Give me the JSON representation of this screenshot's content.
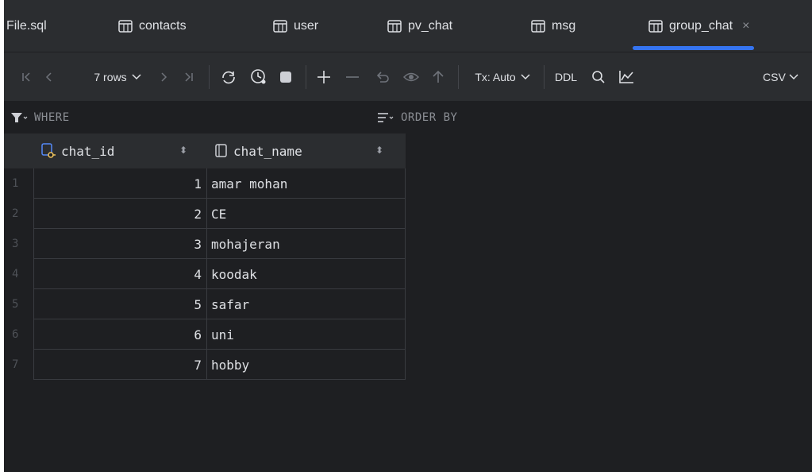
{
  "tabs": [
    {
      "label": "File.sql",
      "icon": "none"
    },
    {
      "label": "contacts",
      "icon": "table-icon"
    },
    {
      "label": "user",
      "icon": "table-icon"
    },
    {
      "label": "pv_chat",
      "icon": "table-icon"
    },
    {
      "label": "msg",
      "icon": "table-icon"
    },
    {
      "label": "group_chat",
      "icon": "table-icon",
      "active": true,
      "close": "×"
    }
  ],
  "toolbar": {
    "rows_label": "7 rows",
    "tx_label": "Tx: Auto",
    "ddl_label": "DDL",
    "csv_label": "CSV"
  },
  "filter": {
    "where_label": "WHERE",
    "order_label": "ORDER BY"
  },
  "grid": {
    "columns": [
      {
        "name": "chat_id",
        "icon": "primary-key-icon"
      },
      {
        "name": "chat_name",
        "icon": "column-icon"
      }
    ],
    "rows": [
      {
        "num": "1",
        "chat_id": "1",
        "chat_name": "amar mohan"
      },
      {
        "num": "2",
        "chat_id": "2",
        "chat_name": "CE"
      },
      {
        "num": "3",
        "chat_id": "3",
        "chat_name": "mohajeran"
      },
      {
        "num": "4",
        "chat_id": "4",
        "chat_name": "koodak"
      },
      {
        "num": "5",
        "chat_id": "5",
        "chat_name": "safar"
      },
      {
        "num": "6",
        "chat_id": "6",
        "chat_name": "uni"
      },
      {
        "num": "7",
        "chat_id": "7",
        "chat_name": "hobby"
      }
    ]
  },
  "colors": {
    "background": "#1e1f22",
    "panel": "#2b2d30",
    "accent": "#3574f0",
    "text": "#dfe1e5"
  }
}
